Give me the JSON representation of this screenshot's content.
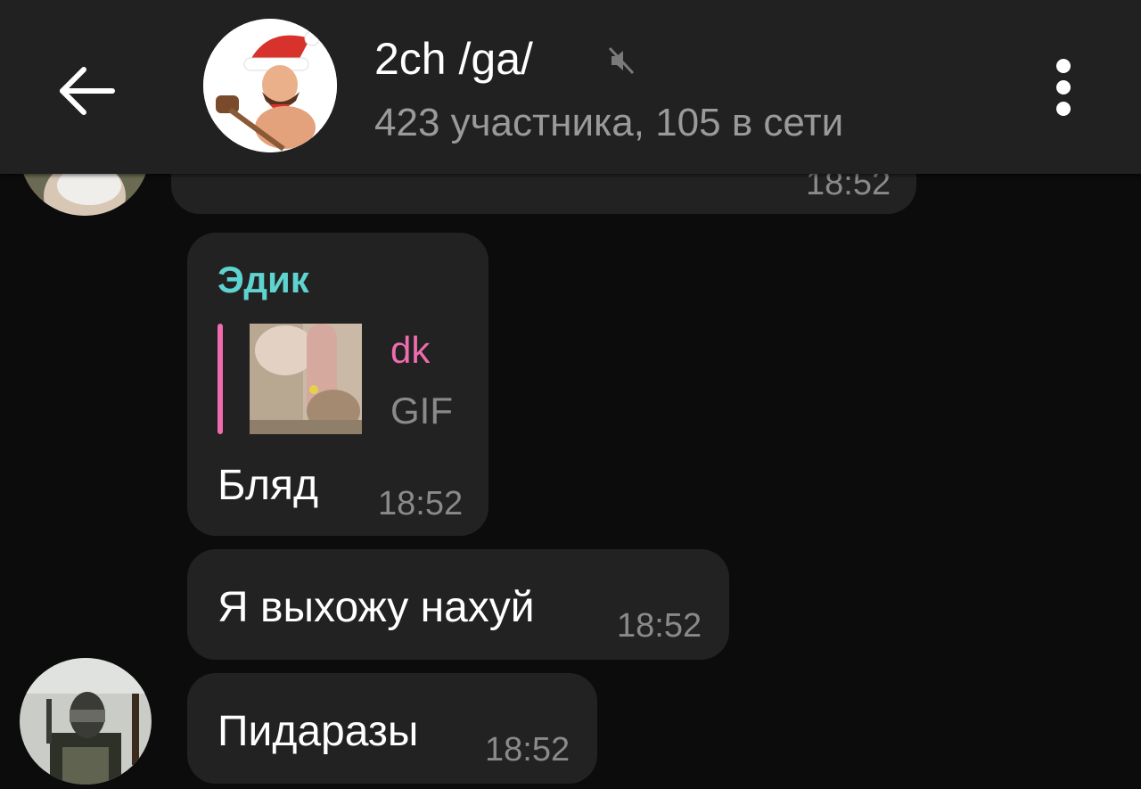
{
  "header": {
    "title": "2ch /ga/",
    "subtitle": "423 участника, 105 в сети",
    "back_icon": "arrow-left-icon",
    "mute_icon": "muted-speaker-icon",
    "menu_icon": "more-vertical-icon"
  },
  "messages": [
    {
      "text": "",
      "time": "18:52",
      "partially_hidden": true
    },
    {
      "sender": "Эдик",
      "reply": {
        "author": "dk",
        "type": "GIF"
      },
      "text": "Бляд",
      "time": "18:52"
    },
    {
      "text": "Я выхожу нахуй",
      "time": "18:52"
    },
    {
      "text": "Пидаразы",
      "time": "18:52"
    }
  ],
  "colors": {
    "header_bg": "#212121",
    "chat_bg": "#0c0c0c",
    "bubble_bg": "#222222",
    "sender_name": "#5ed3d0",
    "reply_accent": "#ef6cae",
    "secondary_text": "#9a9a9a"
  }
}
